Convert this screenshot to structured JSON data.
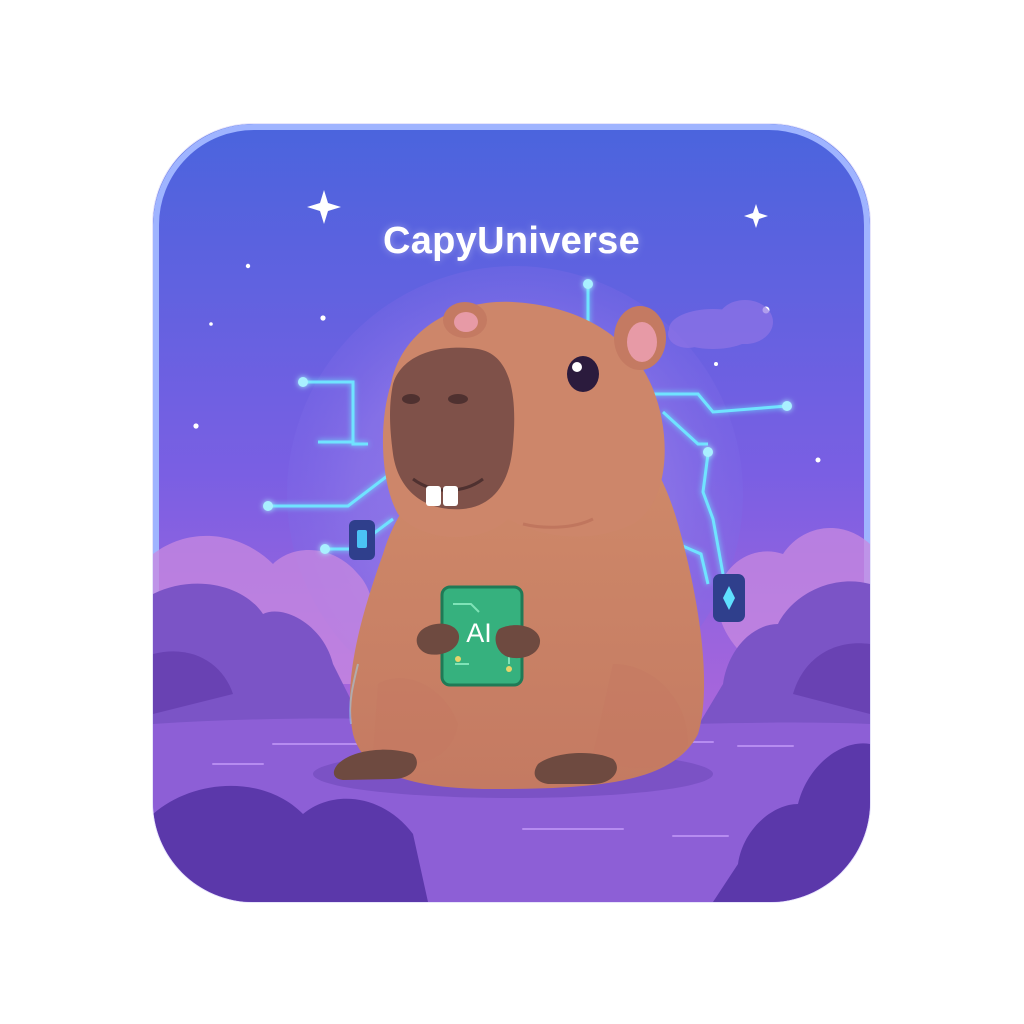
{
  "app": {
    "title": "CapyUniverse",
    "chip_label": "AI"
  },
  "colors": {
    "sky_top": "#4a64dd",
    "sky_mid": "#8b5fe0",
    "sky_bottom": "#b266d6",
    "border": "#8fa8f5",
    "capybara_body": "#cc8464",
    "capybara_snout": "#7f5149",
    "chip": "#36b17e",
    "circuit_glow": "#6fe3ff"
  },
  "icons": {
    "main": "capybara-illustration",
    "decor": [
      "sparkle-icon",
      "sparkle-icon",
      "circuit-lines",
      "cloud-icon"
    ]
  }
}
